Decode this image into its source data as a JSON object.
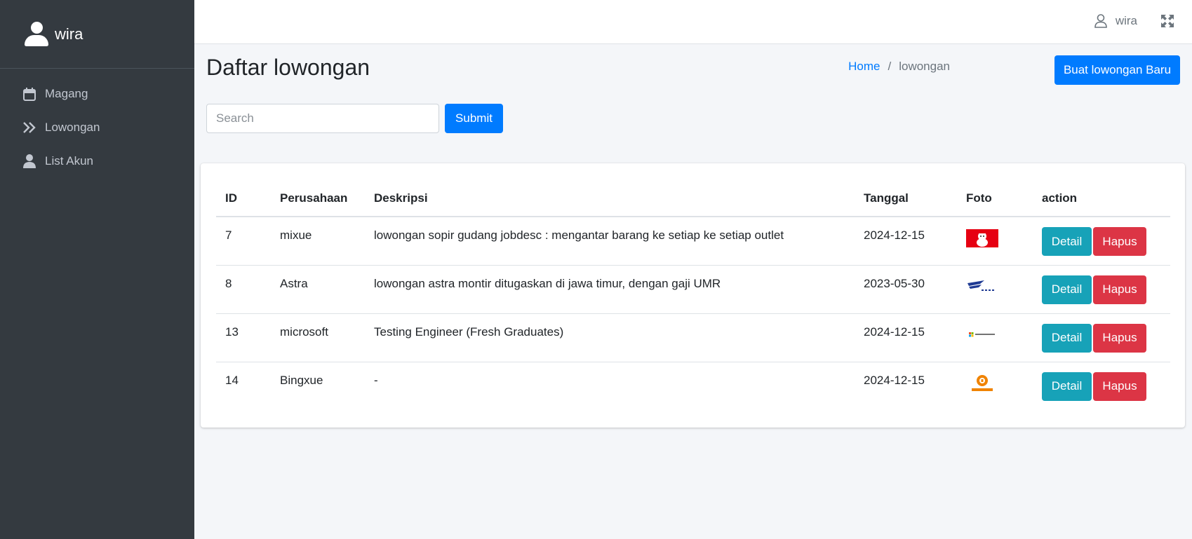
{
  "sidebar": {
    "brand_name": "wira",
    "items": [
      {
        "label": "Magang",
        "icon": "calendar-icon"
      },
      {
        "label": "Lowongan",
        "icon": "double-chevron-right-icon"
      },
      {
        "label": "List Akun",
        "icon": "user-icon"
      }
    ]
  },
  "topbar": {
    "user_name": "wira",
    "icons": [
      "user-outline-icon",
      "fullscreen-expand-icon"
    ]
  },
  "header": {
    "title": "Daftar lowongan",
    "breadcrumb": {
      "home": "Home",
      "separator": "/",
      "current": "lowongan"
    },
    "new_button_label": "Buat lowongan Baru"
  },
  "search": {
    "placeholder": "Search",
    "value": "",
    "submit_label": "Submit"
  },
  "table": {
    "columns": [
      "ID",
      "Perusahaan",
      "Deskripsi",
      "Tanggal",
      "Foto",
      "action"
    ],
    "rows": [
      {
        "id": "7",
        "perusahaan": "mixue",
        "deskripsi": "lowongan sopir gudang jobdesc : mengantar barang ke setiap ke setiap outlet",
        "tanggal": "2024-12-15",
        "foto": "mixue-logo",
        "detail_label": "Detail",
        "hapus_label": "Hapus"
      },
      {
        "id": "8",
        "perusahaan": "Astra",
        "deskripsi": "lowongan astra montir ditugaskan di jawa timur, dengan gaji UMR",
        "tanggal": "2023-05-30",
        "foto": "astra-logo",
        "detail_label": "Detail",
        "hapus_label": "Hapus"
      },
      {
        "id": "13",
        "perusahaan": "microsoft",
        "deskripsi": "Testing Engineer (Fresh Graduates)",
        "tanggal": "2024-12-15",
        "foto": "microsoft-logo",
        "detail_label": "Detail",
        "hapus_label": "Hapus"
      },
      {
        "id": "14",
        "perusahaan": "Bingxue",
        "deskripsi": "-",
        "tanggal": "2024-12-15",
        "foto": "bingxue-logo",
        "detail_label": "Detail",
        "hapus_label": "Hapus"
      }
    ]
  },
  "colors": {
    "sidebar_bg": "#343a40",
    "primary": "#007bff",
    "info": "#17a2b8",
    "danger": "#dc3545",
    "content_bg": "#f4f6f9"
  }
}
